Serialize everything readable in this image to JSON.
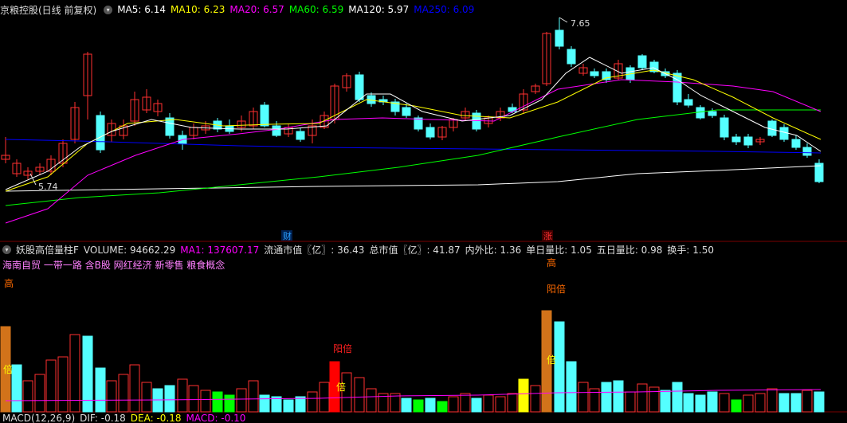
{
  "header": {
    "stock_name": "京粮控股(日线 前复权)",
    "ma_labels": [
      {
        "text": "MA5: 6.14",
        "color": "#ffffff"
      },
      {
        "text": "MA10: 6.23",
        "color": "#ffff00"
      },
      {
        "text": "MA20: 6.57",
        "color": "#ff00ff"
      },
      {
        "text": "MA60: 6.59",
        "color": "#00ff00"
      },
      {
        "text": "MA120: 5.97",
        "color": "#ffffff"
      },
      {
        "text": "MA250: 6.09",
        "color": "#0000ff"
      }
    ]
  },
  "price_panel": {
    "high_label": "7.65",
    "low_label": "5.74",
    "markers": [
      {
        "text": "财",
        "color": "#2aa0ff"
      },
      {
        "text": "涨",
        "color": "#ff3030"
      }
    ]
  },
  "volume_panel": {
    "title": "妖股高倍量柱F",
    "stats": [
      {
        "text": "VOLUME: 94662.29",
        "color": "#dddddd"
      },
      {
        "text": "MA1: 137607.17",
        "color": "#ff00ff"
      },
      {
        "text": "流通市值〖亿〗: 36.43",
        "color": "#dddddd"
      },
      {
        "text": "总市值〖亿〗: 41.87",
        "color": "#dddddd"
      },
      {
        "text": "内外比: 1.36",
        "color": "#dddddd"
      },
      {
        "text": "单日量比: 1.05",
        "color": "#dddddd"
      },
      {
        "text": "五日量比: 0.98",
        "color": "#dddddd"
      },
      {
        "text": "换手: 1.50",
        "color": "#dddddd"
      }
    ],
    "concepts": "海南自贸 一带一路 含B股 网红经济 新零售 粮食概念",
    "labels": {
      "gao1": "高",
      "bei1": "倍",
      "yangbei1": "阳倍",
      "bei2": "倍",
      "gao2": "高",
      "yangbei2": "阳倍",
      "bei3": "倍"
    }
  },
  "macd_panel": {
    "title": "MACD(12,26,9)",
    "stats": [
      {
        "text": "DIF: -0.18",
        "color": "#dddddd"
      },
      {
        "text": "DEA: -0.18",
        "color": "#ffff00"
      },
      {
        "text": "MACD: -0.10",
        "color": "#ff00ff"
      }
    ]
  },
  "colors": {
    "up": "#ff3030",
    "down": "#54ffff",
    "ma5": "#ffffff",
    "ma10": "#ffff00",
    "ma20": "#ff00ff",
    "ma60": "#00ff00",
    "ma120": "#ffffff",
    "ma250": "#0000ff",
    "vol_special_orange": "#d2731a",
    "vol_special_red": "#ff0000",
    "vol_special_yellow": "#ffff00",
    "vol_special_green": "#00ff00"
  }
}
